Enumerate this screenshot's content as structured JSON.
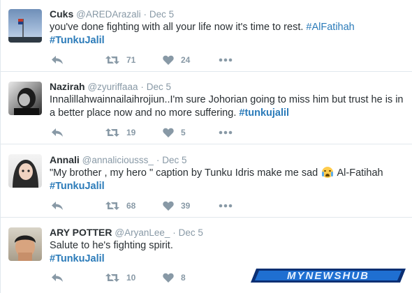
{
  "tweets": [
    {
      "name": "Cuks",
      "handle": "@AREDArazali",
      "separator": "·",
      "time": "Dec 5",
      "text": "you've done fighting with all your life now it's time to rest.",
      "hashtag_inline": "#AlFatihah",
      "hashtag_line": "#TunkuJalil",
      "retweets": "71",
      "likes": "24",
      "avatar": "flag-pole-sky"
    },
    {
      "name": "Nazirah",
      "handle": "@zyuriffaaa",
      "separator": "·",
      "time": "Dec 5",
      "text": "Innalillahwainnailaihrojiun..I'm sure Johorian going to miss him but trust he is in a better place now and no more suffering.",
      "hashtag_inline": "#tunkujalil",
      "retweets": "19",
      "likes": "5",
      "avatar": "bw-portrait"
    },
    {
      "name": "Annali",
      "handle": "@annaliciousss_",
      "separator": "·",
      "time": "Dec 5",
      "text_before": "\"My brother , my hero \" caption by Tunku Idris make me sad",
      "emoji": "crying-face-emoji",
      "text_after": "Al-Fatihah",
      "hashtag_line": "#TunkuJalil",
      "retweets": "68",
      "likes": "39",
      "avatar": "hijab-portrait"
    },
    {
      "name": "ARY POTTER",
      "handle": "@AryanLee_",
      "separator": "·",
      "time": "Dec 5",
      "text": "Salute to he's fighting spirit.",
      "hashtag_line": "#TunkuJalil",
      "retweets": "10",
      "likes": "8",
      "avatar": "boy-face-portrait"
    }
  ],
  "icons": {
    "reply": "reply-icon",
    "retweet": "retweet-icon",
    "like": "heart-icon",
    "more": "more-dots-icon"
  },
  "watermark": "MYNEWSHUB",
  "colors": {
    "link": "#2b7bb9",
    "muted": "#8899a6",
    "text": "#292f33",
    "border": "#e1e8ed"
  }
}
